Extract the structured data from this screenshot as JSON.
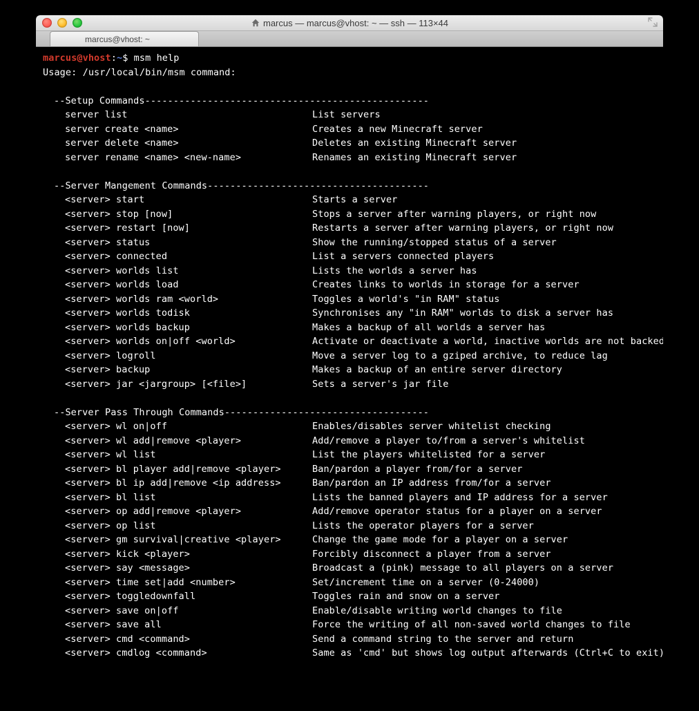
{
  "window": {
    "title": "marcus — marcus@vhost: ~ — ssh — 113×44",
    "tab_label": "marcus@vhost: ~"
  },
  "prompt": {
    "user": "marcus",
    "host": "vhost",
    "path": "~",
    "symbol": "$",
    "typed": "msm help"
  },
  "usage": "Usage: /usr/local/bin/msm command:",
  "sections": [
    {
      "title": "--Setup Commands",
      "dashes": "--------------------------------------------------",
      "rows": [
        {
          "cmd": "server list",
          "desc": "List servers"
        },
        {
          "cmd": "server create <name>",
          "desc": "Creates a new Minecraft server"
        },
        {
          "cmd": "server delete <name>",
          "desc": "Deletes an existing Minecraft server"
        },
        {
          "cmd": "server rename <name> <new-name>",
          "desc": "Renames an existing Minecraft server"
        }
      ]
    },
    {
      "title": "--Server Mangement Commands",
      "dashes": "---------------------------------------",
      "rows": [
        {
          "cmd": "<server> start",
          "desc": "Starts a server"
        },
        {
          "cmd": "<server> stop [now]",
          "desc": "Stops a server after warning players, or right now"
        },
        {
          "cmd": "<server> restart [now]",
          "desc": "Restarts a server after warning players, or right now"
        },
        {
          "cmd": "<server> status",
          "desc": "Show the running/stopped status of a server"
        },
        {
          "cmd": "<server> connected",
          "desc": "List a servers connected players"
        },
        {
          "cmd": "<server> worlds list",
          "desc": "Lists the worlds a server has"
        },
        {
          "cmd": "<server> worlds load",
          "desc": "Creates links to worlds in storage for a server"
        },
        {
          "cmd": "<server> worlds ram <world>",
          "desc": "Toggles a world's \"in RAM\" status"
        },
        {
          "cmd": "<server> worlds todisk",
          "desc": "Synchronises any \"in RAM\" worlds to disk a server has"
        },
        {
          "cmd": "<server> worlds backup",
          "desc": "Makes a backup of all worlds a server has"
        },
        {
          "cmd": "<server> worlds on|off <world>",
          "desc": "Activate or deactivate a world, inactive worlds are not backed up"
        },
        {
          "cmd": "<server> logroll",
          "desc": "Move a server log to a gziped archive, to reduce lag"
        },
        {
          "cmd": "<server> backup",
          "desc": "Makes a backup of an entire server directory"
        },
        {
          "cmd": "<server> jar <jargroup> [<file>]",
          "desc": "Sets a server's jar file"
        }
      ]
    },
    {
      "title": "--Server Pass Through Commands",
      "dashes": "------------------------------------",
      "rows": [
        {
          "cmd": "<server> wl on|off",
          "desc": "Enables/disables server whitelist checking"
        },
        {
          "cmd": "<server> wl add|remove <player>",
          "desc": "Add/remove a player to/from a server's whitelist"
        },
        {
          "cmd": "<server> wl list",
          "desc": "List the players whitelisted for a server"
        },
        {
          "cmd": "<server> bl player add|remove <player>",
          "desc": "Ban/pardon a player from/for a server"
        },
        {
          "cmd": "<server> bl ip add|remove <ip address>",
          "desc": "Ban/pardon an IP address from/for a server"
        },
        {
          "cmd": "<server> bl list",
          "desc": "Lists the banned players and IP address for a server"
        },
        {
          "cmd": "<server> op add|remove <player>",
          "desc": "Add/remove operator status for a player on a server"
        },
        {
          "cmd": "<server> op list",
          "desc": "Lists the operator players for a server"
        },
        {
          "cmd": "<server> gm survival|creative <player>",
          "desc": "Change the game mode for a player on a server"
        },
        {
          "cmd": "<server> kick <player>",
          "desc": "Forcibly disconnect a player from a server"
        },
        {
          "cmd": "<server> say <message>",
          "desc": "Broadcast a (pink) message to all players on a server"
        },
        {
          "cmd": "<server> time set|add <number>",
          "desc": "Set/increment time on a server (0-24000)"
        },
        {
          "cmd": "<server> toggledownfall",
          "desc": "Toggles rain and snow on a server"
        },
        {
          "cmd": "<server> save on|off",
          "desc": "Enable/disable writing world changes to file"
        },
        {
          "cmd": "<server> save all",
          "desc": "Force the writing of all non-saved world changes to file"
        },
        {
          "cmd": "<server> cmd <command>",
          "desc": "Send a command string to the server and return"
        },
        {
          "cmd": "<server> cmdlog <command>",
          "desc": "Same as 'cmd' but shows log output afterwards (Ctrl+C to exit)"
        }
      ]
    }
  ]
}
